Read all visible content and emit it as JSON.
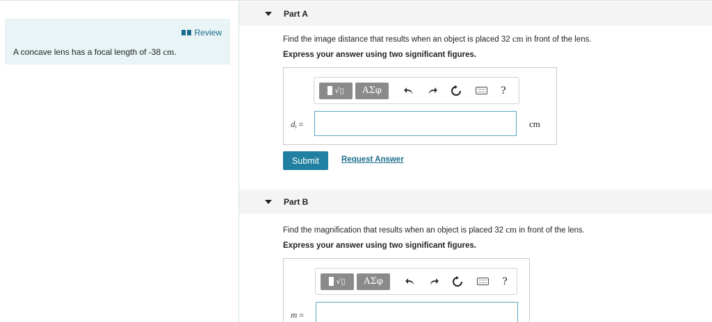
{
  "left_panel": {
    "review_label": "Review",
    "problem_text": "A concave lens has a focal length of -38",
    "problem_unit": "cm."
  },
  "part_a": {
    "title": "Part A",
    "question_pre": "Find the image distance that results when an object is placed 32",
    "question_unit": "cm",
    "question_post": "in front of the lens.",
    "instruction": "Express your answer using two significant figures.",
    "variable": "d",
    "variable_sub": "i",
    "equals": "=",
    "input_value": "",
    "unit": "cm",
    "submit_label": "Submit",
    "request_label": "Request Answer"
  },
  "part_b": {
    "title": "Part B",
    "question_pre": "Find the magnification that results when an object is placed 32",
    "question_unit": "cm",
    "question_post": "in front of the lens.",
    "instruction": "Express your answer using two significant figures.",
    "variable": "m",
    "equals": "=",
    "input_value": ""
  },
  "toolbar": {
    "symbols_label": "ΑΣφ",
    "help_label": "?",
    "icons": [
      "templates-icon",
      "symbols-icon",
      "undo-icon",
      "redo-icon",
      "reset-icon",
      "keyboard-icon",
      "help-icon"
    ]
  },
  "colors": {
    "accent": "#2180a1",
    "link": "#1a6d8c",
    "panel_bg": "#e8f4f6",
    "header_bg": "#f4f4f4",
    "input_border": "#5ba6c4"
  }
}
